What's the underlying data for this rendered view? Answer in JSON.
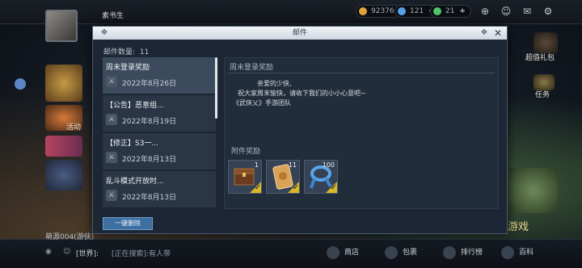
{
  "hud": {
    "player_name": "素书生",
    "resources": [
      {
        "value": "92376",
        "color": "#e0a23a"
      },
      {
        "value": "121",
        "color": "#5aa0e8"
      },
      {
        "value": "21",
        "color": "#4cc56a"
      }
    ],
    "right_labels": {
      "gift": "超值礼包",
      "task": "任务",
      "game": "游戏",
      "wiki": "百科"
    },
    "left_labels": {
      "activity": "活动"
    },
    "bottom": {
      "chat_channel": "[世界]:",
      "chat_msg": "[正在搜索]:有人带",
      "team_text": "萌源004(游侠)",
      "buttons": [
        "商店",
        "包裹",
        "排行榜",
        "百科"
      ]
    }
  },
  "mail": {
    "title": "邮件",
    "count_label": "邮件数量:",
    "count_value": "11",
    "items": [
      {
        "subject": "周末登录奖励",
        "date": "2022年8月26日",
        "selected": true
      },
      {
        "subject": "【公告】恶意组...",
        "date": "2022年8月19日",
        "selected": false
      },
      {
        "subject": "【修正】S3一...",
        "date": "2022年8月13日",
        "selected": false
      },
      {
        "subject": "乱斗模式开放时...",
        "date": "2022年8月13日",
        "selected": false
      }
    ],
    "detail": {
      "title": "周末登录奖励",
      "lines": [
        "亲爱的少侠,",
        "祝大家周末愉快，请收下我们的小小心意吧~",
        "《武侠乂》手游团队"
      ],
      "attachments_title": "附件奖励",
      "attachments": [
        {
          "icon": "treasure-chest-icon",
          "qty": "1"
        },
        {
          "icon": "scroll-token-icon",
          "qty": "11"
        },
        {
          "icon": "blue-ribbon-icon",
          "qty": "100"
        }
      ]
    },
    "delete_all_label": "一键删除"
  }
}
